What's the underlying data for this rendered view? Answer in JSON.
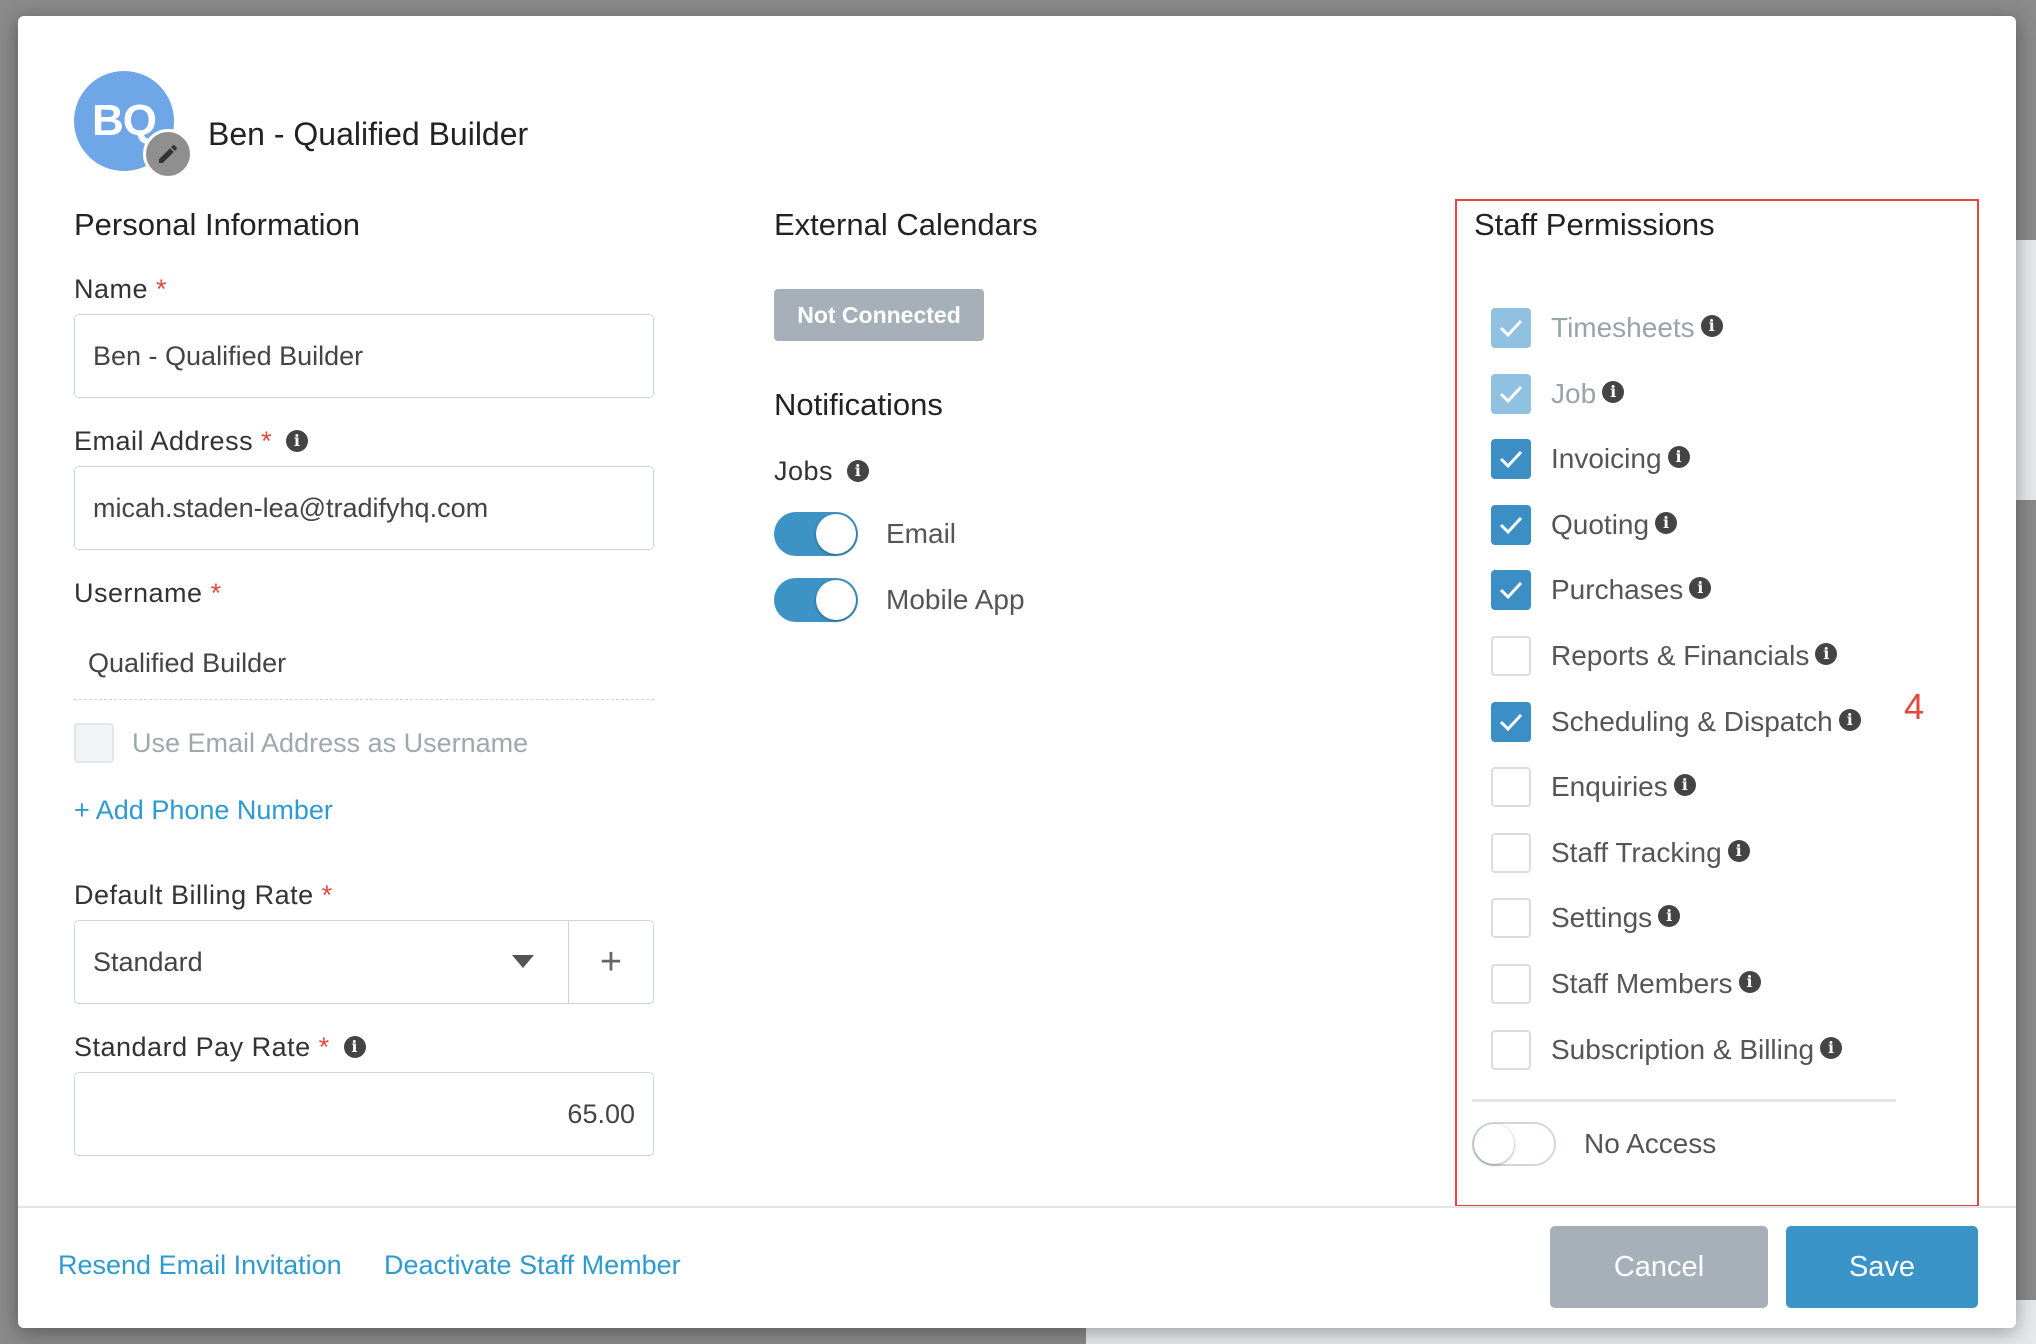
{
  "user": {
    "initials": "BQ",
    "name": "Ben - Qualified Builder"
  },
  "personal": {
    "title": "Personal Information",
    "name_label": "Name",
    "name_value": "Ben - Qualified Builder",
    "email_label": "Email Address",
    "email_value": "micah.staden-lea@tradifyhq.com",
    "username_label": "Username",
    "username_value": "Qualified Builder",
    "use_email_label": "Use Email Address as Username",
    "add_phone": "+ Add Phone Number",
    "billing_label": "Default Billing Rate",
    "billing_value": "Standard",
    "add_symbol": "+",
    "pay_label": "Standard Pay Rate",
    "pay_value": "65.00",
    "required_mark": "*"
  },
  "calendars": {
    "title": "External Calendars",
    "status": "Not Connected"
  },
  "notifications": {
    "title": "Notifications",
    "jobs_label": "Jobs",
    "toggles": [
      {
        "label": "Email",
        "on": true
      },
      {
        "label": "Mobile App",
        "on": true
      }
    ]
  },
  "permissions": {
    "title": "Staff Permissions",
    "items": [
      {
        "label": "Timesheets",
        "state": "disabled"
      },
      {
        "label": "Job",
        "state": "disabled"
      },
      {
        "label": "Invoicing",
        "state": "checked"
      },
      {
        "label": "Quoting",
        "state": "checked"
      },
      {
        "label": "Purchases",
        "state": "checked"
      },
      {
        "label": "Reports & Financials",
        "state": "unchecked"
      },
      {
        "label": "Scheduling & Dispatch",
        "state": "checked"
      },
      {
        "label": "Enquiries",
        "state": "unchecked"
      },
      {
        "label": "Staff Tracking",
        "state": "unchecked"
      },
      {
        "label": "Settings",
        "state": "unchecked"
      },
      {
        "label": "Staff Members",
        "state": "unchecked"
      },
      {
        "label": "Subscription & Billing",
        "state": "unchecked"
      }
    ],
    "no_access_label": "No Access",
    "no_access_on": false,
    "annotation": "4"
  },
  "footer": {
    "resend": "Resend Email Invitation",
    "deactivate": "Deactivate Staff Member",
    "cancel": "Cancel",
    "save": "Save"
  },
  "colors": {
    "primary": "#3b8fc4",
    "link": "#2d9ad1",
    "required": "#e04a3f",
    "annotation": "#e2473a"
  }
}
